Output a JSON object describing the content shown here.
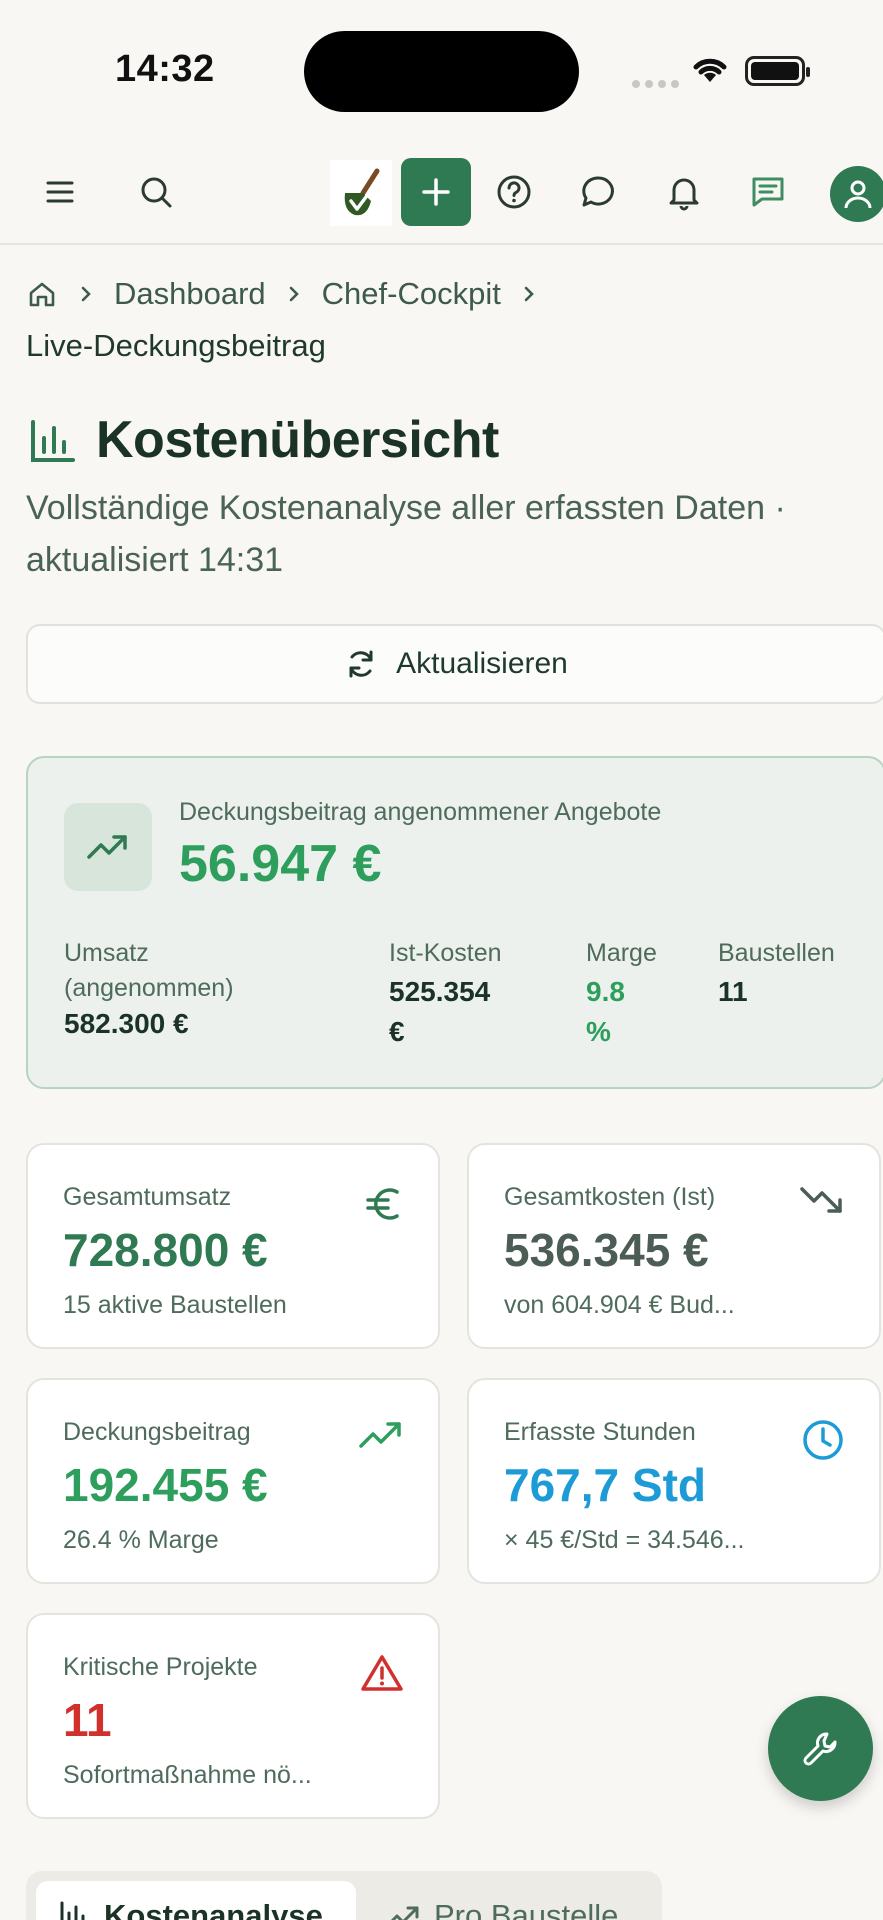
{
  "status_bar": {
    "time": "14:32"
  },
  "breadcrumb": {
    "items": [
      "Dashboard",
      "Chef-Cockpit"
    ],
    "current": "Live-Deckungsbeitrag"
  },
  "page": {
    "title": "Kostenübersicht",
    "subtitle": "Vollständige Kostenanalyse aller erfassten Daten · aktualisiert 14:31",
    "refresh_label": "Aktualisieren"
  },
  "contribution_card": {
    "label": "Deckungsbeitrag angenommener Angebote",
    "value": "56.947 €",
    "stats": {
      "revenue_label_1": "Umsatz",
      "revenue_label_2": "(angenommen)",
      "revenue_value": "582.300 €",
      "costs_label": "Ist-Kosten",
      "costs_value_1": "525.354",
      "costs_value_2": "€",
      "margin_label": "Marge",
      "margin_value_1": "9.8",
      "margin_value_2": "%",
      "sites_label": "Baustellen",
      "sites_value": "11"
    }
  },
  "kpis": {
    "total_revenue": {
      "label": "Gesamtumsatz",
      "value": "728.800 €",
      "sub": "15 aktive Baustellen",
      "icon": "euro-icon"
    },
    "total_costs": {
      "label": "Gesamtkosten (Ist)",
      "value": "536.345 €",
      "sub": "von 604.904 € Bud...",
      "icon": "trending-down-icon"
    },
    "contribution": {
      "label": "Deckungsbeitrag",
      "value": "192.455 €",
      "sub": "26.4 % Marge",
      "icon": "trending-up-icon"
    },
    "hours": {
      "label": "Erfasste Stunden",
      "value": "767,7 Std",
      "sub": "× 45 €/Std = 34.546...",
      "icon": "clock-icon"
    },
    "critical": {
      "label": "Kritische Projekte",
      "value": "11",
      "sub": "Sofortmaßnahme nö...",
      "icon": "warning-icon"
    }
  },
  "tabs": [
    {
      "label": "Kostenanalyse",
      "active": true
    },
    {
      "label": "Pro Baustelle",
      "active": false
    }
  ],
  "colors": {
    "brand": "#2f7a52",
    "positive": "#2e9e5c",
    "info": "#1d9bd7",
    "danger": "#d0312d",
    "neutral_value": "#4b5d55"
  }
}
